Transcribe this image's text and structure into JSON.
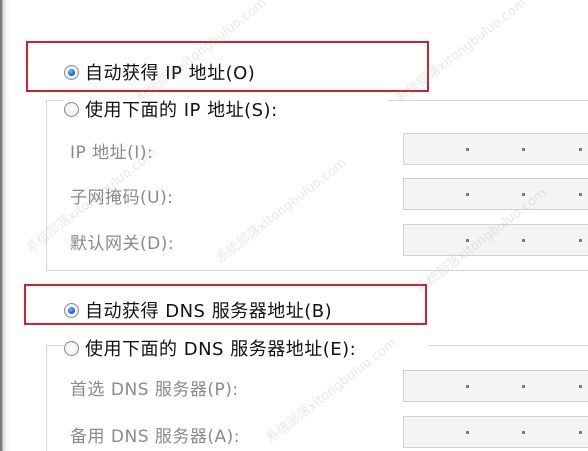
{
  "auto_ip_label": "自动获得 IP 地址(O)",
  "manual_ip_label": "使用下面的 IP 地址(S):",
  "ip_fields": [
    {
      "label": "IP 地址(I):"
    },
    {
      "label": "子网掩码(U):"
    },
    {
      "label": "默认网关(D):"
    }
  ],
  "auto_dns_label": "自动获得 DNS 服务器地址(B)",
  "manual_dns_label": "使用下面的 DNS 服务器地址(E):",
  "dns_fields": [
    {
      "label": "首选 DNS 服务器(P):"
    },
    {
      "label": "备用 DNS 服务器(A):"
    }
  ],
  "ip_dot_separator": ".",
  "watermark": "系统部落xitongbuluo.com",
  "colors": {
    "highlight": "#c7252b",
    "disabled_text": "#8a8a8a",
    "radio_checked": "#1b6fc8"
  }
}
